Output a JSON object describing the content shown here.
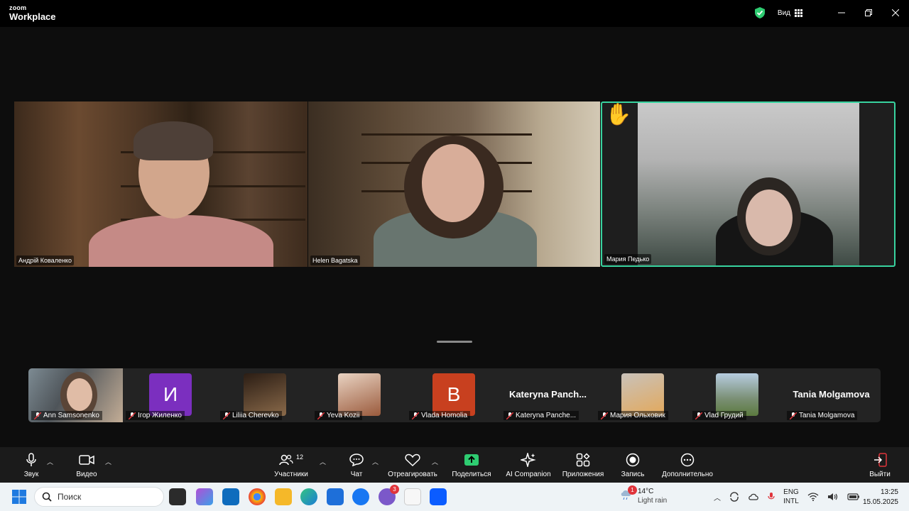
{
  "app": {
    "logo_top": "zoom",
    "logo_bottom": "Workplace"
  },
  "titlebar": {
    "view_label": "Вид"
  },
  "speakers": [
    {
      "name": "Андрій Коваленко"
    },
    {
      "name": "Helen Bagatska"
    },
    {
      "name": "Мария Педько"
    }
  ],
  "gallery": [
    {
      "name": "Ann Samsonenko",
      "type": "photo"
    },
    {
      "name": "Ігор Жиленко",
      "type": "letter",
      "letter": "И",
      "color": "#7b2fbf"
    },
    {
      "name": "Liliia Cherevko",
      "type": "photo"
    },
    {
      "name": "Yeva Kozii",
      "type": "photo"
    },
    {
      "name": "Vlada Homolia",
      "type": "letter",
      "letter": "B",
      "color": "#c8401f"
    },
    {
      "name": "Kateryna Panche...",
      "type": "text",
      "big": "Kateryna  Panch..."
    },
    {
      "name": "Мария Ольховик",
      "type": "photo"
    },
    {
      "name": "Vlad Грудий",
      "type": "photo"
    },
    {
      "name": "Tania Molgamova",
      "type": "text",
      "big": "Tania Molgamova"
    }
  ],
  "toolbar": {
    "audio": "Звук",
    "video": "Видео",
    "participants": "Участники",
    "participants_count": "12",
    "chat": "Чат",
    "react": "Отреагировать",
    "share": "Поделиться",
    "ai": "AI Companion",
    "apps": "Приложения",
    "record": "Запись",
    "more": "Дополнительно",
    "leave": "Выйти"
  },
  "taskbar": {
    "search_placeholder": "Поиск",
    "messenger_badge": "3",
    "weather_badge": "1",
    "weather_temp": "14°C",
    "weather_desc": "Light rain",
    "lang_1": "ENG",
    "lang_2": "INTL",
    "time": "13:25",
    "date": "15.05.2025"
  },
  "colors": {
    "active_speaker": "#38d39f",
    "share_green": "#2ecc71",
    "leave_red": "#e0343b"
  }
}
